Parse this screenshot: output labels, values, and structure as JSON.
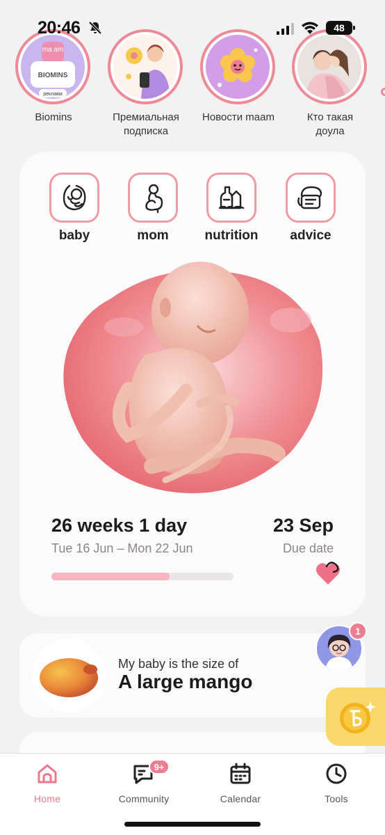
{
  "status_bar": {
    "time": "20:46",
    "battery": "48",
    "icons": [
      "bell-off-icon",
      "signal-icon",
      "wifi-icon",
      "battery-icon"
    ]
  },
  "stories": [
    {
      "label": "Biomins",
      "brand_top": "ma am",
      "brand_mid": "BIOMINS",
      "tag": "реклама",
      "icon": "biomins-ad"
    },
    {
      "label": "Премиальная подписка",
      "icon": "premium-subscription"
    },
    {
      "label": "Новости maam",
      "icon": "news-flower"
    },
    {
      "label": "Кто такая доула",
      "icon": "doula-photo"
    }
  ],
  "categories": [
    {
      "label": "baby",
      "icon": "baby-icon"
    },
    {
      "label": "mom",
      "icon": "mom-icon"
    },
    {
      "label": "nutrition",
      "icon": "nutrition-icon"
    },
    {
      "label": "advice",
      "icon": "advice-icon"
    }
  ],
  "pregnancy": {
    "weeks_text": "26 weeks 1 day",
    "date_range": "Tue 16 Jun – Mon 22 Jun",
    "due_date": "23 Sep",
    "due_label": "Due date",
    "progress_percent": 65
  },
  "size": {
    "label": "My baby is the size of",
    "value": "A large mango",
    "icon": "mango-icon"
  },
  "assistant": {
    "badge": "1"
  },
  "nav": [
    {
      "label": "Home",
      "icon": "home-icon",
      "active": true
    },
    {
      "label": "Community",
      "icon": "community-icon",
      "badge": "9+"
    },
    {
      "label": "Calendar",
      "icon": "calendar-icon"
    },
    {
      "label": "Tools",
      "icon": "clock-icon"
    }
  ],
  "colors": {
    "accent": "#ee8a98",
    "active_nav": "#e9798a",
    "coin": "#fbd66b",
    "progress": "#f7b4be"
  }
}
